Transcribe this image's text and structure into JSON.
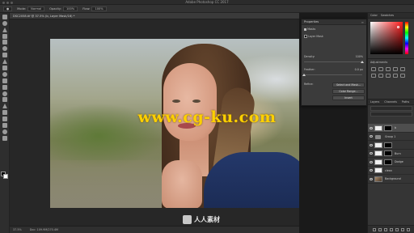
{
  "app": {
    "window_title": "Adobe Photoshop CC 2017"
  },
  "options_bar": {
    "mode_label": "Mode:",
    "mode_value": "Normal",
    "opacity_label": "Opacity:",
    "opacity_value": "100%",
    "flow_label": "Flow:",
    "flow_value": "100%"
  },
  "document": {
    "tab_title": "DSC2058.tif @ 37.5% (b, Layer Mask/16) *"
  },
  "status_bar": {
    "zoom": "37.5%",
    "doc_size": "Doc: 109.9M/270.4M"
  },
  "watermark": {
    "text": "www.cg-ku.com",
    "corner_text": "人人素材"
  },
  "properties_panel": {
    "title": "Properties",
    "mask_label": "Masks",
    "layer_mask_label": "Layer Mask",
    "density_label": "Density:",
    "density_value": "100%",
    "feather_label": "Feather:",
    "feather_value": "0.0 px",
    "refine_label": "Refine:",
    "select_and_mask": "Select and Mask...",
    "color_range": "Color Range...",
    "invert": "Invert"
  },
  "color_panel": {
    "tabs": [
      "Color",
      "Swatches"
    ],
    "accent": "#ff1a1a"
  },
  "adjustments_panel": {
    "title": "Adjustments"
  },
  "layers_panel": {
    "tabs": [
      "Layers",
      "Channels",
      "Paths"
    ],
    "layers": [
      {
        "name": "b",
        "thumb": "white",
        "has_mask": true,
        "selected": true
      },
      {
        "name": "Group 1",
        "thumb": "folder",
        "has_mask": false,
        "selected": false
      },
      {
        "name": "",
        "thumb": "white",
        "has_mask": true,
        "selected": false
      },
      {
        "name": "Burn",
        "thumb": "white",
        "has_mask": true,
        "selected": false
      },
      {
        "name": "Dodge",
        "thumb": "white",
        "has_mask": true,
        "selected": false
      },
      {
        "name": "clean",
        "thumb": "white",
        "has_mask": false,
        "selected": false
      },
      {
        "name": "Background",
        "thumb": "photo",
        "has_mask": false,
        "selected": false
      }
    ]
  }
}
